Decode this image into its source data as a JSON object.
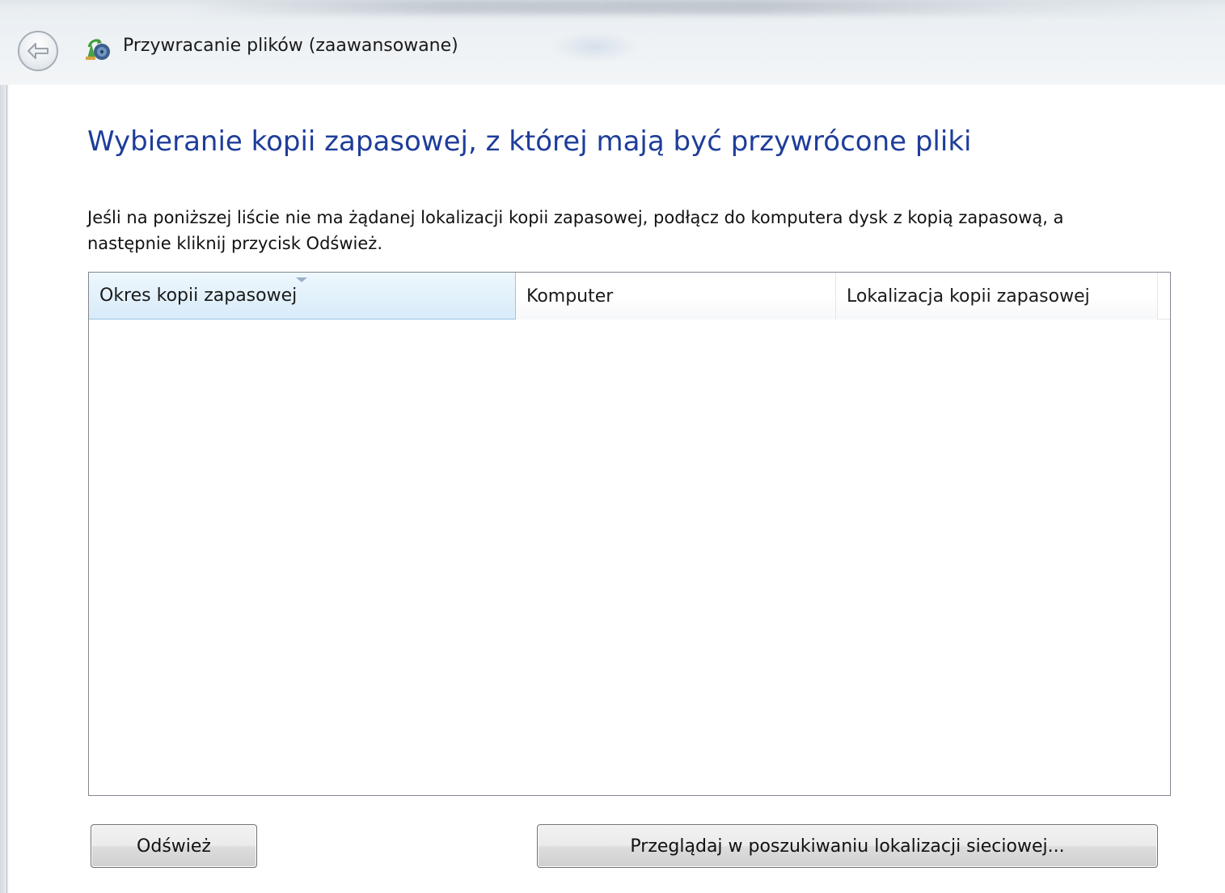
{
  "window": {
    "title": "Przywracanie plików (zaawansowane)"
  },
  "page": {
    "heading": "Wybieranie kopii zapasowej, z której mają być przywrócone pliki",
    "instruction": "Jeśli na poniższej liście nie ma żądanej lokalizacji kopii zapasowej, podłącz do komputera dysk z kopią zapasową, a następnie kliknij przycisk Odśwież."
  },
  "list": {
    "columns": [
      {
        "label": "Okres kopii zapasowej",
        "sorted": true
      },
      {
        "label": "Komputer",
        "sorted": false
      },
      {
        "label": "Lokalizacja kopii zapasowej",
        "sorted": false
      }
    ],
    "rows": []
  },
  "buttons": {
    "refresh_label": "Odśwież",
    "browse_label": "Przeglądaj w poszukiwaniu lokalizacji sieciowej..."
  },
  "colors": {
    "heading": "#1e3d9a",
    "sorted_column": "#d8ecf9"
  },
  "icons": {
    "back": "back-arrow-icon",
    "app": "backup-restore-icon"
  }
}
